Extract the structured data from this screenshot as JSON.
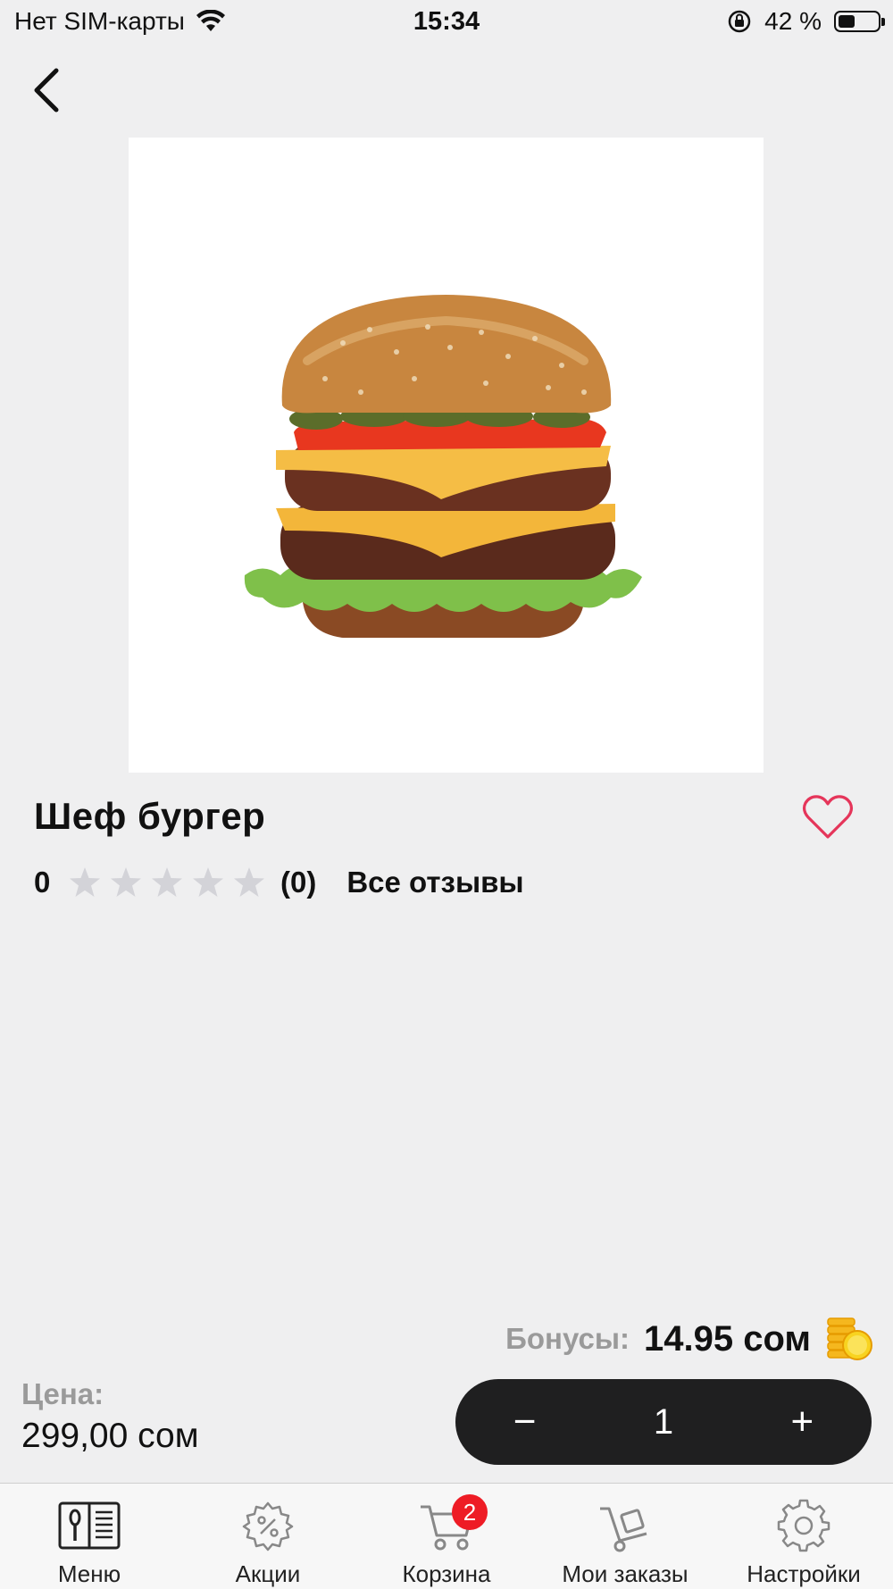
{
  "status_bar": {
    "carrier": "Нет SIM-карты",
    "time": "15:34",
    "battery": "42 %",
    "battery_level": 0.42
  },
  "product": {
    "title": "Шеф бургер",
    "image": "burger-image",
    "rating_value": "0",
    "rating_stars": 0,
    "rating_max": 5,
    "review_count": "(0)",
    "all_reviews_label": "Все отзывы"
  },
  "bonus": {
    "label": "Бонусы:",
    "value": "14.95 сом"
  },
  "price": {
    "label": "Цена:",
    "value": "299,00 сом"
  },
  "quantity": {
    "minus": "−",
    "value": "1",
    "plus": "+"
  },
  "tab_bar": {
    "tabs": [
      {
        "label": "Меню",
        "icon": "menu-book-icon"
      },
      {
        "label": "Акции",
        "icon": "discount-gear-icon"
      },
      {
        "label": "Корзина",
        "icon": "cart-icon",
        "badge": "2"
      },
      {
        "label": "Мои заказы",
        "icon": "trolley-icon"
      },
      {
        "label": "Настройки",
        "icon": "settings-gear-icon"
      }
    ]
  },
  "colors": {
    "background": "#efeff0",
    "accent_red": "#ee1c25",
    "heart": "#e5355a",
    "stepper": "#1f1f20",
    "star_empty": "#d3d3d8",
    "muted_label": "#9a9a9a",
    "coin": "#f5c518"
  }
}
